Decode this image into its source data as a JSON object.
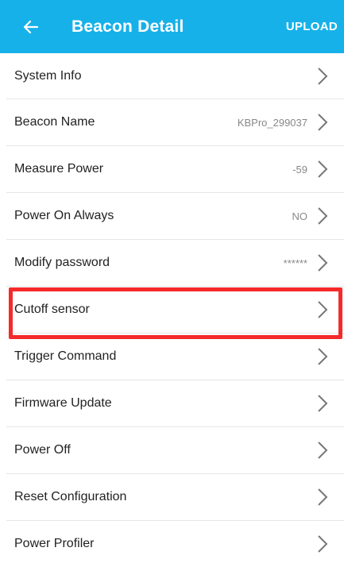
{
  "header": {
    "back_icon": "arrow-left-icon",
    "title": "Beacon Detail",
    "upload_label": "UPLOAD",
    "background_color": "#17b1e9"
  },
  "items": [
    {
      "label": "System Info",
      "value": ""
    },
    {
      "label": "Beacon Name",
      "value": "KBPro_299037"
    },
    {
      "label": "Measure Power",
      "value": "-59"
    },
    {
      "label": "Power On Always",
      "value": "NO"
    },
    {
      "label": "Modify password",
      "value": "******"
    },
    {
      "label": "Cutoff sensor",
      "value": ""
    },
    {
      "label": "Trigger Command",
      "value": ""
    },
    {
      "label": "Firmware Update",
      "value": ""
    },
    {
      "label": "Power Off",
      "value": ""
    },
    {
      "label": "Reset Configuration",
      "value": ""
    },
    {
      "label": "Power Profiler",
      "value": ""
    }
  ],
  "highlight": {
    "item": "Cutoff sensor",
    "color": "#f52a2a"
  },
  "chevron_icon": "chevron-right-icon"
}
